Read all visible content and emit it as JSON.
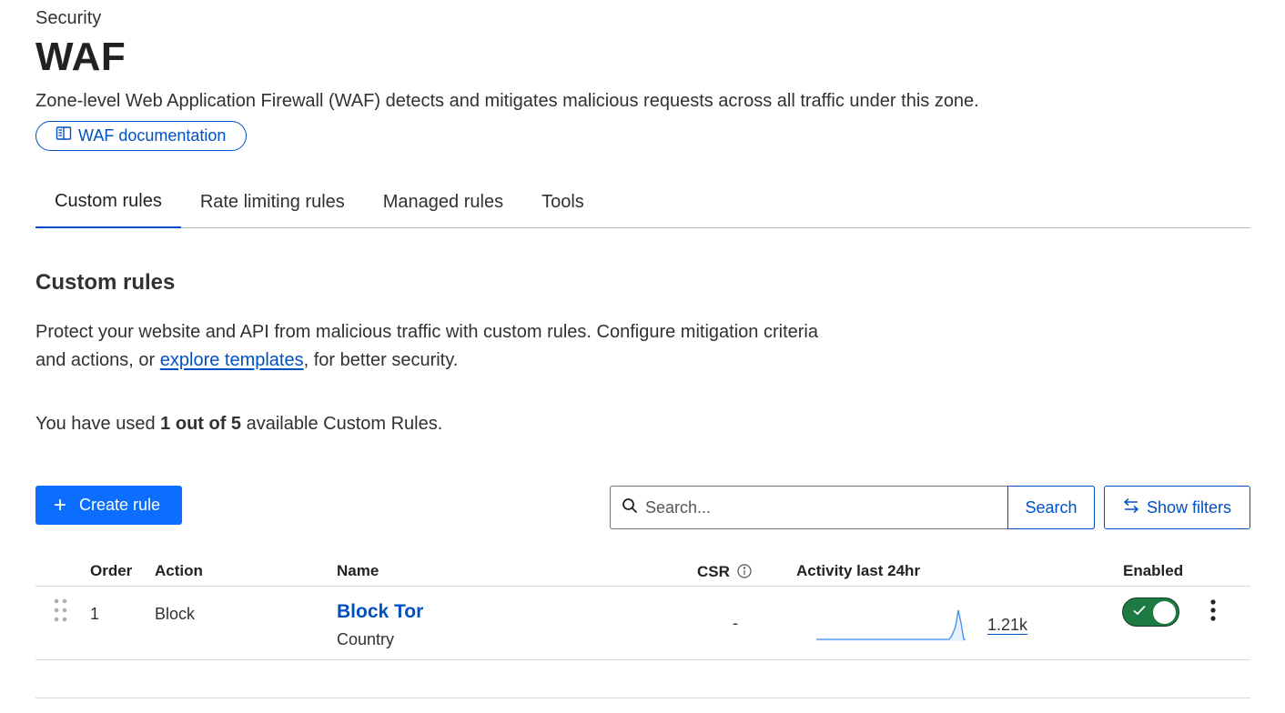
{
  "header": {
    "breadcrumb": "Security",
    "title": "WAF",
    "description": "Zone-level Web Application Firewall (WAF) detects and mitigates malicious requests across all traffic under this zone.",
    "doc_button": "WAF documentation"
  },
  "tabs": [
    {
      "label": "Custom rules",
      "active": true
    },
    {
      "label": "Rate limiting rules",
      "active": false
    },
    {
      "label": "Managed rules",
      "active": false
    },
    {
      "label": "Tools",
      "active": false
    }
  ],
  "section": {
    "title": "Custom rules",
    "desc_before": "Protect your website and API from malicious traffic with custom rules. Configure mitigation criteria and actions, or ",
    "desc_link": "explore templates",
    "desc_after": ", for better security.",
    "usage_before": "You have used ",
    "usage_bold": "1 out of 5",
    "usage_after": " available Custom Rules."
  },
  "toolbar": {
    "create_label": "Create rule",
    "search_placeholder": "Search...",
    "search_button": "Search",
    "filters_button": "Show filters"
  },
  "table": {
    "columns": {
      "order": "Order",
      "action": "Action",
      "name": "Name",
      "csr": "CSR",
      "activity": "Activity last 24hr",
      "enabled": "Enabled"
    },
    "rows": [
      {
        "order": "1",
        "action": "Block",
        "name": "Block Tor",
        "subtitle": "Country",
        "csr": "-",
        "activity_count": "1.21k",
        "enabled": true
      }
    ]
  },
  "colors": {
    "accent": "#0051c3",
    "primary_button": "#0b6eff",
    "toggle_on": "#1d7a43"
  },
  "icons": {
    "doc": "book-icon",
    "create": "plus-icon",
    "search": "search-icon",
    "filters": "swap-arrows-icon",
    "csr_info": "info-icon",
    "drag": "drag-handle-icon",
    "toggle": "check-icon",
    "menu": "kebab-menu-icon"
  }
}
